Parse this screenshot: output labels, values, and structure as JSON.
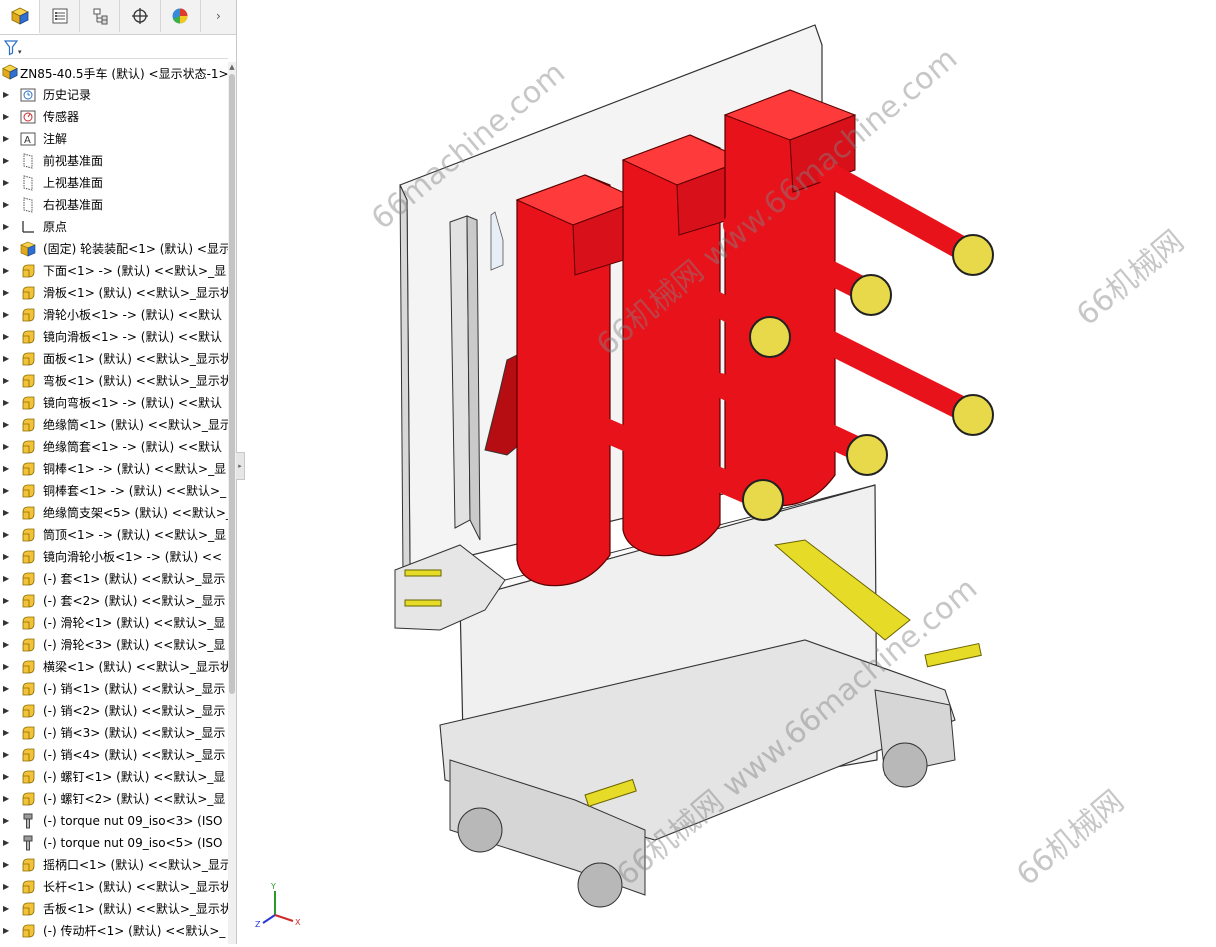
{
  "tabs": [
    {
      "name": "feature-manager",
      "icon": "cube-icon"
    },
    {
      "name": "property-manager",
      "icon": "properties-list-icon"
    },
    {
      "name": "configuration-manager",
      "icon": "configuration-icon"
    },
    {
      "name": "dimxpert-manager",
      "icon": "crosshair-icon"
    },
    {
      "name": "display-manager",
      "icon": "appearance-pie-icon"
    }
  ],
  "tab_more_glyph": "›",
  "filter_caret": "▾",
  "tree": {
    "root": "ZN85-40.5手车 (默认) <显示状态-1>",
    "items": [
      {
        "label": "历史记录",
        "icon": "history-icon"
      },
      {
        "label": "传感器",
        "icon": "sensor-icon"
      },
      {
        "label": "注解",
        "icon": "annotation-icon"
      },
      {
        "label": "前视基准面",
        "icon": "plane-icon"
      },
      {
        "label": "上视基准面",
        "icon": "plane-icon"
      },
      {
        "label": "右视基准面",
        "icon": "plane-icon"
      },
      {
        "label": "原点",
        "icon": "origin-icon"
      },
      {
        "label": "(固定) 轮装装配<1> (默认) <显示",
        "icon": "subassembly-icon"
      },
      {
        "label": "下面<1> -> (默认) <<默认>_显",
        "icon": "part-icon"
      },
      {
        "label": "滑板<1> (默认) <<默认>_显示状",
        "icon": "part-icon"
      },
      {
        "label": "滑轮小板<1> -> (默认) <<默认",
        "icon": "part-icon"
      },
      {
        "label": "镜向滑板<1> -> (默认) <<默认",
        "icon": "part-icon"
      },
      {
        "label": "面板<1> (默认) <<默认>_显示状",
        "icon": "part-icon"
      },
      {
        "label": "弯板<1> (默认) <<默认>_显示状",
        "icon": "part-icon"
      },
      {
        "label": "镜向弯板<1> -> (默认) <<默认",
        "icon": "part-icon"
      },
      {
        "label": "绝缘筒<1> (默认) <<默认>_显示",
        "icon": "part-icon"
      },
      {
        "label": "绝缘筒套<1> -> (默认) <<默认",
        "icon": "part-icon"
      },
      {
        "label": "铜棒<1> -> (默认) <<默认>_显",
        "icon": "part-icon"
      },
      {
        "label": "铜棒套<1> -> (默认) <<默认>_",
        "icon": "part-icon"
      },
      {
        "label": "绝缘筒支架<5> (默认) <<默认>_",
        "icon": "part-icon"
      },
      {
        "label": "筒顶<1> -> (默认) <<默认>_显",
        "icon": "part-icon"
      },
      {
        "label": "镜向滑轮小板<1> -> (默认) <<",
        "icon": "part-icon"
      },
      {
        "label": "(-) 套<1> (默认) <<默认>_显示",
        "icon": "part-icon"
      },
      {
        "label": "(-) 套<2> (默认) <<默认>_显示",
        "icon": "part-icon"
      },
      {
        "label": "(-) 滑轮<1> (默认) <<默认>_显",
        "icon": "part-icon"
      },
      {
        "label": "(-) 滑轮<3> (默认) <<默认>_显",
        "icon": "part-icon"
      },
      {
        "label": "横梁<1> (默认) <<默认>_显示状",
        "icon": "part-icon"
      },
      {
        "label": "(-) 销<1> (默认) <<默认>_显示",
        "icon": "part-icon"
      },
      {
        "label": "(-) 销<2> (默认) <<默认>_显示",
        "icon": "part-icon"
      },
      {
        "label": "(-) 销<3> (默认) <<默认>_显示",
        "icon": "part-icon"
      },
      {
        "label": "(-) 销<4> (默认) <<默认>_显示",
        "icon": "part-icon"
      },
      {
        "label": "(-) 螺钉<1> (默认) <<默认>_显",
        "icon": "part-icon"
      },
      {
        "label": "(-) 螺钉<2> (默认) <<默认>_显",
        "icon": "part-icon"
      },
      {
        "label": "(-) torque nut 09_iso<3> (ISO",
        "icon": "toolbox-part-icon"
      },
      {
        "label": "(-) torque nut 09_iso<5> (ISO",
        "icon": "toolbox-part-icon"
      },
      {
        "label": "摇柄口<1> (默认) <<默认>_显示",
        "icon": "part-icon"
      },
      {
        "label": "长杆<1> (默认) <<默认>_显示状",
        "icon": "part-icon"
      },
      {
        "label": "舌板<1> (默认) <<默认>_显示状",
        "icon": "part-icon"
      },
      {
        "label": "(-) 传动杆<1> (默认) <<默认>_",
        "icon": "part-icon"
      }
    ]
  },
  "viewport": {
    "model": "vacuum-circuit-breaker-trolley",
    "triad_axes": [
      "Y",
      "Z",
      "X"
    ],
    "watermarks": [
      "66machine.com",
      "www.66machine.com",
      "66机械网",
      "66机械网 www.66machine.com",
      "66机械网",
      "66机械网"
    ],
    "colors": {
      "insulator": "#e8121a",
      "insulator_dark": "#b50d12",
      "contact": "#e8d94a",
      "frame": "#e4e4e4",
      "panel": "#f4f4f4",
      "brass": "#e6dc28"
    }
  }
}
